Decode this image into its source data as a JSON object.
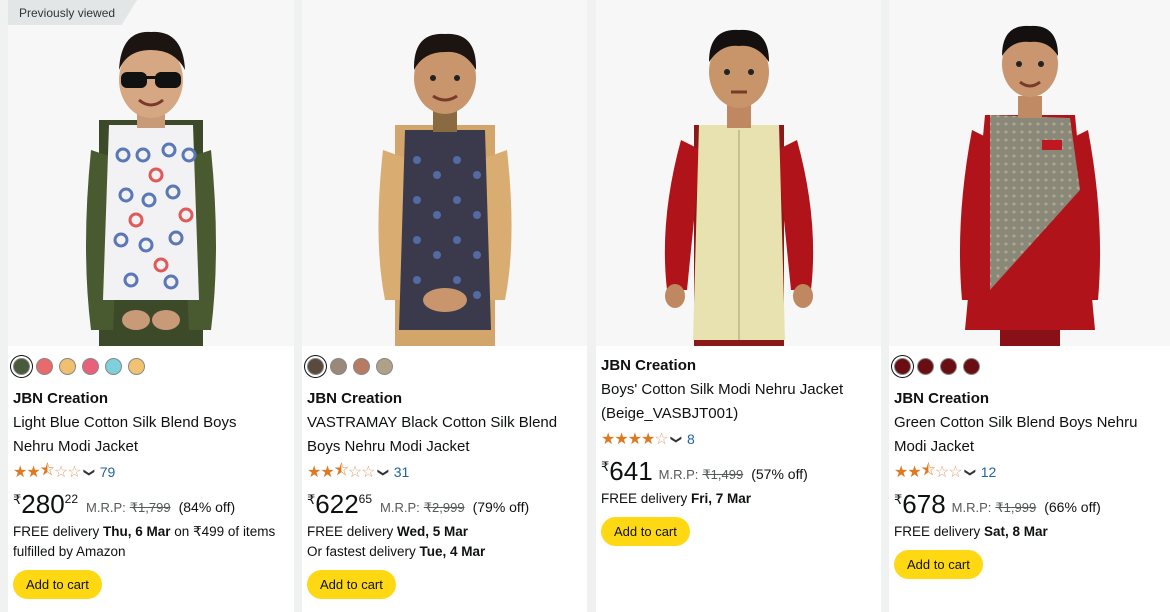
{
  "products": [
    {
      "badge": "Previously viewed",
      "swatches": [
        "#4a5a3c",
        "#e86a6a",
        "#f0c070",
        "#e8607a",
        "#7dd0dc",
        "#f2c272"
      ],
      "brand": "JBN Creation",
      "title_line1": "Light Blue Cotton Silk Blend Boys",
      "title_line2": "Nehru Modi Jacket",
      "rating": 2.5,
      "review_count": "79",
      "price_symbol": "₹",
      "price_whole": "280",
      "price_fraction": "22",
      "mrp_label": "M.R.P:",
      "mrp_value": "₹1,799",
      "discount": "(84% off)",
      "delivery_prefix": "FREE delivery ",
      "delivery_date": "Thu, 6 Mar",
      "delivery_suffix": " on ₹499 of items",
      "delivery_line2": "fulfilled by Amazon",
      "add_to_cart": "Add to cart",
      "image_alt": "boy in printed sunglasses-pattern Nehru jacket with green kurta"
    },
    {
      "badge": "",
      "swatches": [
        "#5a4a3e",
        "#9a8878",
        "#b87a62",
        "#b0a088"
      ],
      "brand": "JBN Creation",
      "title_line1": "VASTRAMAY Black Cotton Silk Blend",
      "title_line2": "Boys Nehru Modi Jacket",
      "rating": 2.5,
      "review_count": "31",
      "price_symbol": "₹",
      "price_whole": "622",
      "price_fraction": "65",
      "mrp_label": "M.R.P:",
      "mrp_value": "₹2,999",
      "discount": "(79% off)",
      "delivery_prefix": "FREE delivery ",
      "delivery_date": "Wed, 5 Mar",
      "delivery_line2_prefix": "Or fastest delivery ",
      "delivery_line2_date": "Tue, 4 Mar",
      "add_to_cart": "Add to cart",
      "image_alt": "boy in black patterned Nehru jacket with gold kurta"
    },
    {
      "brand": "JBN Creation",
      "title_line1": "Boys' Cotton Silk Modi Nehru Jacket",
      "title_line2": "(Beige_VASBJT001)",
      "rating": 4,
      "review_count": "8",
      "price_symbol": "₹",
      "price_whole": "641",
      "price_fraction": "",
      "mrp_label": "M.R.P:",
      "mrp_value": "₹1,499",
      "discount": "(57% off)",
      "delivery_prefix": "FREE delivery ",
      "delivery_date": "Fri, 7 Mar",
      "add_to_cart": "Add to cart",
      "image_alt": "boy in beige Nehru jacket with red kurta"
    },
    {
      "swatches": [
        "#6a0e14",
        "#6a0e14",
        "#6a0e14",
        "#6a0e14"
      ],
      "brand": "JBN Creation",
      "title_line1": "Green Cotton Silk Blend Boys Nehru",
      "title_line2": "Modi Jacket",
      "rating": 2.5,
      "review_count": "12",
      "price_symbol": "₹",
      "price_whole": "678",
      "price_fraction": "",
      "mrp_label": "M.R.P:",
      "mrp_value": "₹1,999",
      "discount": "(66% off)",
      "delivery_prefix": "FREE delivery ",
      "delivery_date": "Sat, 8 Mar",
      "add_to_cart": "Add to cart",
      "image_alt": "boy in grey asymmetric jacket with red kurta"
    }
  ],
  "colors": {
    "button": "#ffd814",
    "star": "#de7921",
    "link": "#2162a1"
  }
}
